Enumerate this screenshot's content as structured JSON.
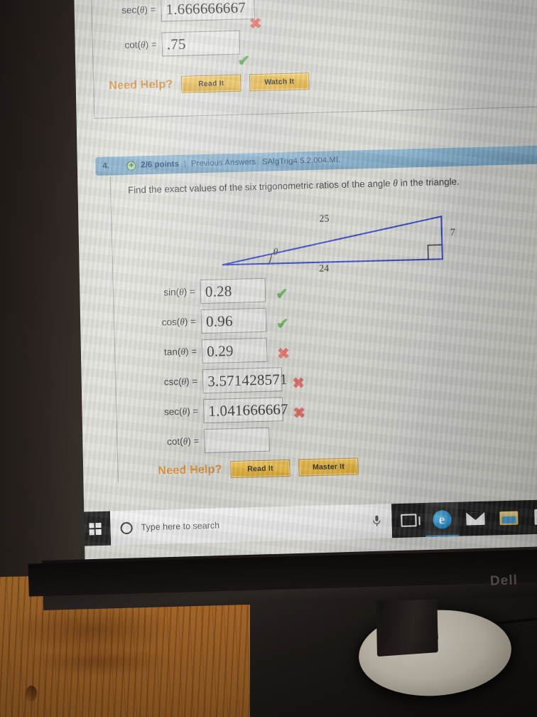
{
  "photo": {
    "monitor_brand": "Dell"
  },
  "prev_question": {
    "rows": [
      {
        "label_prefix": "sec(",
        "label_var": "θ",
        "label_suffix": ") =",
        "value": "1.666666667",
        "mark": "✖",
        "mark_state": "incorrect"
      },
      {
        "label_prefix": "cot(",
        "label_var": "θ",
        "label_suffix": ") =",
        "value": ".75",
        "mark": "✔",
        "mark_state": "correct"
      }
    ],
    "need_help_label": "Need Help?",
    "buttons": [
      {
        "label": "Read It"
      },
      {
        "label": "Watch It"
      }
    ]
  },
  "question": {
    "number": "4.",
    "points": "2/6 points",
    "separator": "|",
    "previous_answers": "Previous Answers",
    "code": "SAlgTrig4 5.2.004.MI.",
    "plus_icon": "+",
    "prompt_before": "Find the exact values of the six trigonometric ratios of the angle ",
    "prompt_var": "θ",
    "prompt_after": " in the triangle.",
    "figure": {
      "hypotenuse_label": "25",
      "opposite_label": "7",
      "adjacent_label": "24",
      "angle_label": "θ",
      "line_color": "#2b39c4"
    },
    "rows": [
      {
        "label_prefix": "sin(",
        "label_var": "θ",
        "label_suffix": ") =",
        "value": "0.28",
        "mark": "✔",
        "mark_state": "correct"
      },
      {
        "label_prefix": "cos(",
        "label_var": "θ",
        "label_suffix": ") =",
        "value": "0.96",
        "mark": "✔",
        "mark_state": "correct"
      },
      {
        "label_prefix": "tan(",
        "label_var": "θ",
        "label_suffix": ") =",
        "value": "0.29",
        "mark": "✖",
        "mark_state": "incorrect"
      },
      {
        "label_prefix": "csc(",
        "label_var": "θ",
        "label_suffix": ") =",
        "value": "3.571428571",
        "mark": "✖",
        "mark_state": "incorrect"
      },
      {
        "label_prefix": "sec(",
        "label_var": "θ",
        "label_suffix": ") =",
        "value": "1.041666667",
        "mark": "✖",
        "mark_state": "incorrect"
      },
      {
        "label_prefix": "cot(",
        "label_var": "θ",
        "label_suffix": ") =",
        "value": "",
        "mark": "",
        "mark_state": "none"
      }
    ],
    "need_help_label": "Need Help?",
    "buttons": [
      {
        "label": "Read It"
      },
      {
        "label": "Master It"
      }
    ]
  },
  "taskbar": {
    "start_icon": "windows-logo-icon",
    "search_placeholder": "Type here to search",
    "search_icon": "search-circle-icon",
    "mic_icon": "microphone-icon",
    "items": [
      {
        "icon": "task-view-icon",
        "name": "task-view"
      },
      {
        "icon": "edge-icon",
        "name": "microsoft-edge",
        "glyph": "e"
      },
      {
        "icon": "mail-icon",
        "name": "mail"
      },
      {
        "icon": "file-explorer-icon",
        "name": "file-explorer"
      },
      {
        "icon": "microsoft-store-icon",
        "name": "microsoft-store"
      }
    ]
  },
  "colors": {
    "accent_bar": "#7aa8c8",
    "help_orange": "#d98b33",
    "correct_green": "#5caa52",
    "incorrect_red": "#e0675f",
    "triangle_blue": "#2b39c4"
  }
}
